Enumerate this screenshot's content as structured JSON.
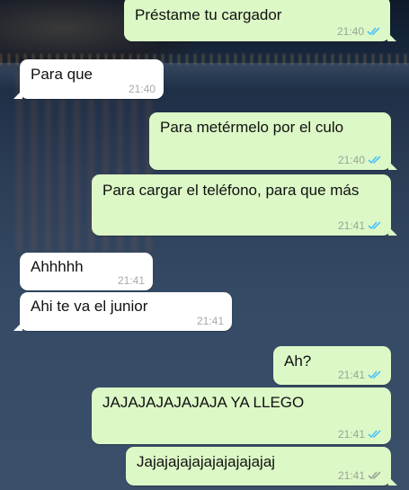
{
  "chat": {
    "messages": [
      {
        "direction": "outgoing",
        "text": "Préstame tu cargador",
        "time": "21:40",
        "status": "read"
      },
      {
        "direction": "incoming",
        "text": "Para que",
        "time": "21:40"
      },
      {
        "direction": "outgoing",
        "text": "Para metérmelo por el culo",
        "time": "21:40",
        "status": "read"
      },
      {
        "direction": "outgoing",
        "text": "Para cargar el teléfono, para que más",
        "time": "21:41",
        "status": "read"
      },
      {
        "direction": "incoming",
        "text": "Ahhhhh",
        "time": "21:41"
      },
      {
        "direction": "incoming",
        "text": "Ahi te va el junior",
        "time": "21:41"
      },
      {
        "direction": "outgoing",
        "text": "Ah?",
        "time": "21:41",
        "status": "read"
      },
      {
        "direction": "outgoing",
        "text": "JAJAJAJAJAJAJA YA LLEGO",
        "time": "21:41",
        "status": "read"
      },
      {
        "direction": "outgoing",
        "text": "Jajajajajajajajajajajaj",
        "time": "21:41",
        "status": "delivered"
      }
    ]
  },
  "colors": {
    "outgoing_bubble": "#dcf8c6",
    "incoming_bubble": "#ffffff",
    "read_tick": "#4fc3f7",
    "delivered_tick": "#9aa39a"
  },
  "icons": {
    "read": "double-check-icon",
    "delivered": "double-check-icon"
  }
}
